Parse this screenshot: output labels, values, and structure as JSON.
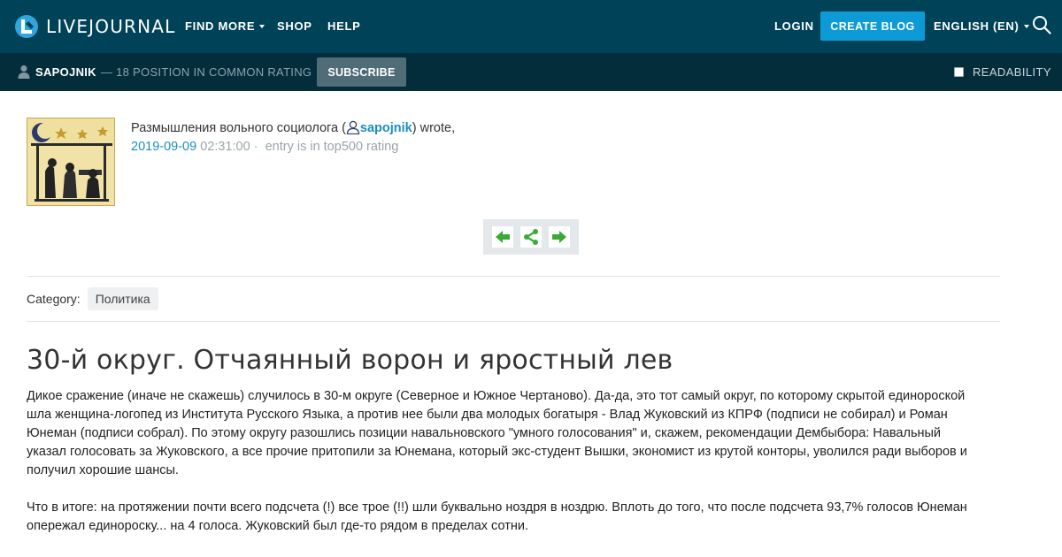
{
  "topbar": {
    "logo_text": "LIVEJOURNAL",
    "find_more": "FIND MORE",
    "shop": "SHOP",
    "help": "HELP",
    "login": "LOGIN",
    "create_blog": "CREATE BLOG",
    "language": "ENGLISH (EN)"
  },
  "subbar": {
    "username": "SAPOJNIK",
    "rating": "— 18 POSITION IN COMMON RATING",
    "subscribe": "SUBSCRIBE",
    "readability": "READABILITY"
  },
  "entry": {
    "journal_title": "Размышления вольного социолога (",
    "poster": "sapojnik",
    "wrote": ") wrote,",
    "date": "2019-09-09",
    "time": "02:31:00 ·",
    "rating_note": "entry is in top500 rating",
    "category_label": "Category:",
    "category_tag": "Политика",
    "title": "30-й округ. Отчаянный ворон и яростный лев",
    "paragraphs": [
      "Дикое сражение (иначе не скажешь) случилось в 30-м округе (Северное и Южное Чертаново). Да-да, это тот самый округ, по которому скрытой единороской шла женщина-логопед из Института Русского Языка, а против нее были два молодых богатыря - Влад Жуковский из КПРФ (подписи не собирал) и Роман Юнеман (подписи собрал). По этому округу разошлись позиции навальновского \"умного голосования\" и, скажем, рекомендации Дембыбора: Навальный указал голосовать за Жуковского, а все прочие притопили за Юнемана, который экс-студент Вышки, экономист из крутой конторы, уволился ради выборов и получил хорошие шансы.",
      "Что в итоге: на протяжении почти всего подсчета (!) все трое (!!) шли буквально ноздря в ноздрю. Вплоть до того, что после подсчета 93,7% голосов Юнеман опережал единороску... на 4 голоса. Жуковский был где-то рядом в пределах сотни."
    ]
  },
  "colors": {
    "topbar": "#004359",
    "subbar": "#042d3c",
    "accent": "#0d9bd5",
    "link": "#1a8ec2",
    "arrow": "#3aaa35"
  }
}
